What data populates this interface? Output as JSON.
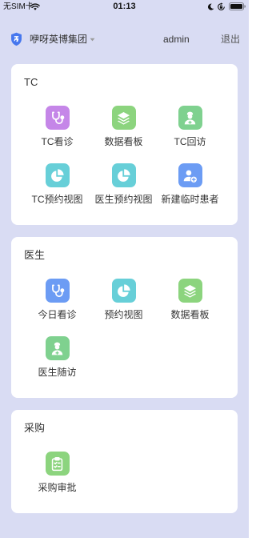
{
  "status_bar": {
    "carrier": "无SIM卡",
    "time": "01:13",
    "icons": [
      "wifi-icon",
      "moon-icon",
      "orientation-lock-icon",
      "battery-icon"
    ]
  },
  "header": {
    "org_icon": "shield-logo-icon",
    "org_name": "咿呀英博集团",
    "username": "admin",
    "logout_label": "退出"
  },
  "theme": {
    "page_background": "#d9dcf3",
    "brand_color": "#4677ee"
  },
  "sections": [
    {
      "title": "TC",
      "items": [
        {
          "label": "TC看诊",
          "icon": "stethoscope-icon",
          "color": "#c586e8"
        },
        {
          "label": "数据看板",
          "icon": "layers-icon",
          "color": "#8cd47e"
        },
        {
          "label": "TC回访",
          "icon": "doctor-icon",
          "color": "#7fd18f"
        },
        {
          "label": "TC预约视图",
          "icon": "pie-chart-icon",
          "color": "#67cfd8"
        },
        {
          "label": "医生预约视图",
          "icon": "pie-chart-icon",
          "color": "#67cfd8"
        },
        {
          "label": "新建临时患者",
          "icon": "user-add-icon",
          "color": "#6c9cf4"
        }
      ]
    },
    {
      "title": "医生",
      "items": [
        {
          "label": "今日看诊",
          "icon": "stethoscope-icon",
          "color": "#6c9cf4"
        },
        {
          "label": "预约视图",
          "icon": "pie-chart-icon",
          "color": "#67cfd8"
        },
        {
          "label": "数据看板",
          "icon": "layers-icon",
          "color": "#8cd47e"
        },
        {
          "label": "医生随访",
          "icon": "doctor-icon",
          "color": "#7fd18f"
        }
      ]
    },
    {
      "title": "采购",
      "items": [
        {
          "label": "采购审批",
          "icon": "clipboard-check-icon",
          "color": "#8cd47e"
        }
      ]
    }
  ]
}
